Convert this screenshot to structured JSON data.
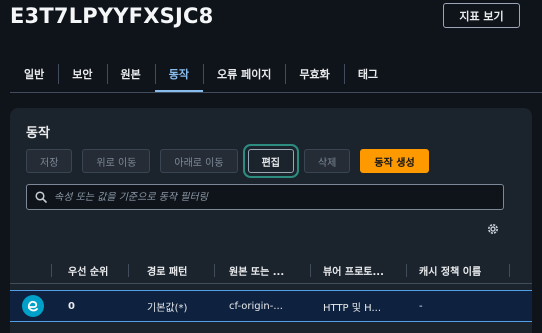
{
  "header": {
    "title": "E3T7LPYYFXSJC8",
    "view_metrics_label": "지표 보기"
  },
  "tabs": [
    {
      "label": "일반"
    },
    {
      "label": "보안"
    },
    {
      "label": "원본"
    },
    {
      "label": "동작",
      "active": true
    },
    {
      "label": "오류 페이지"
    },
    {
      "label": "무효화"
    },
    {
      "label": "태그"
    }
  ],
  "behaviors": {
    "title": "동작",
    "buttons": {
      "save": "저장",
      "move_up": "위로 이동",
      "move_down": "아래로 이동",
      "edit": "편집",
      "delete": "삭제",
      "create": "동작 생성"
    },
    "filter_placeholder": "속성 또는 값을 기준으로 동작 필터링",
    "columns": [
      "우선 순위",
      "경로 패턴",
      "원본 또는 ...",
      "뷰어 프로토...",
      "캐시 정책 이름"
    ],
    "rows": [
      {
        "priority": "0",
        "path": "기본값(*)",
        "origin": "cf-origin-...",
        "viewer": "HTTP 및 H...",
        "cache": "-"
      }
    ]
  },
  "colors": {
    "accent": "#89bdee",
    "primary_button": "#ff9900",
    "selected_row": "#0e2240",
    "highlight_ring": "#2c8c80"
  }
}
